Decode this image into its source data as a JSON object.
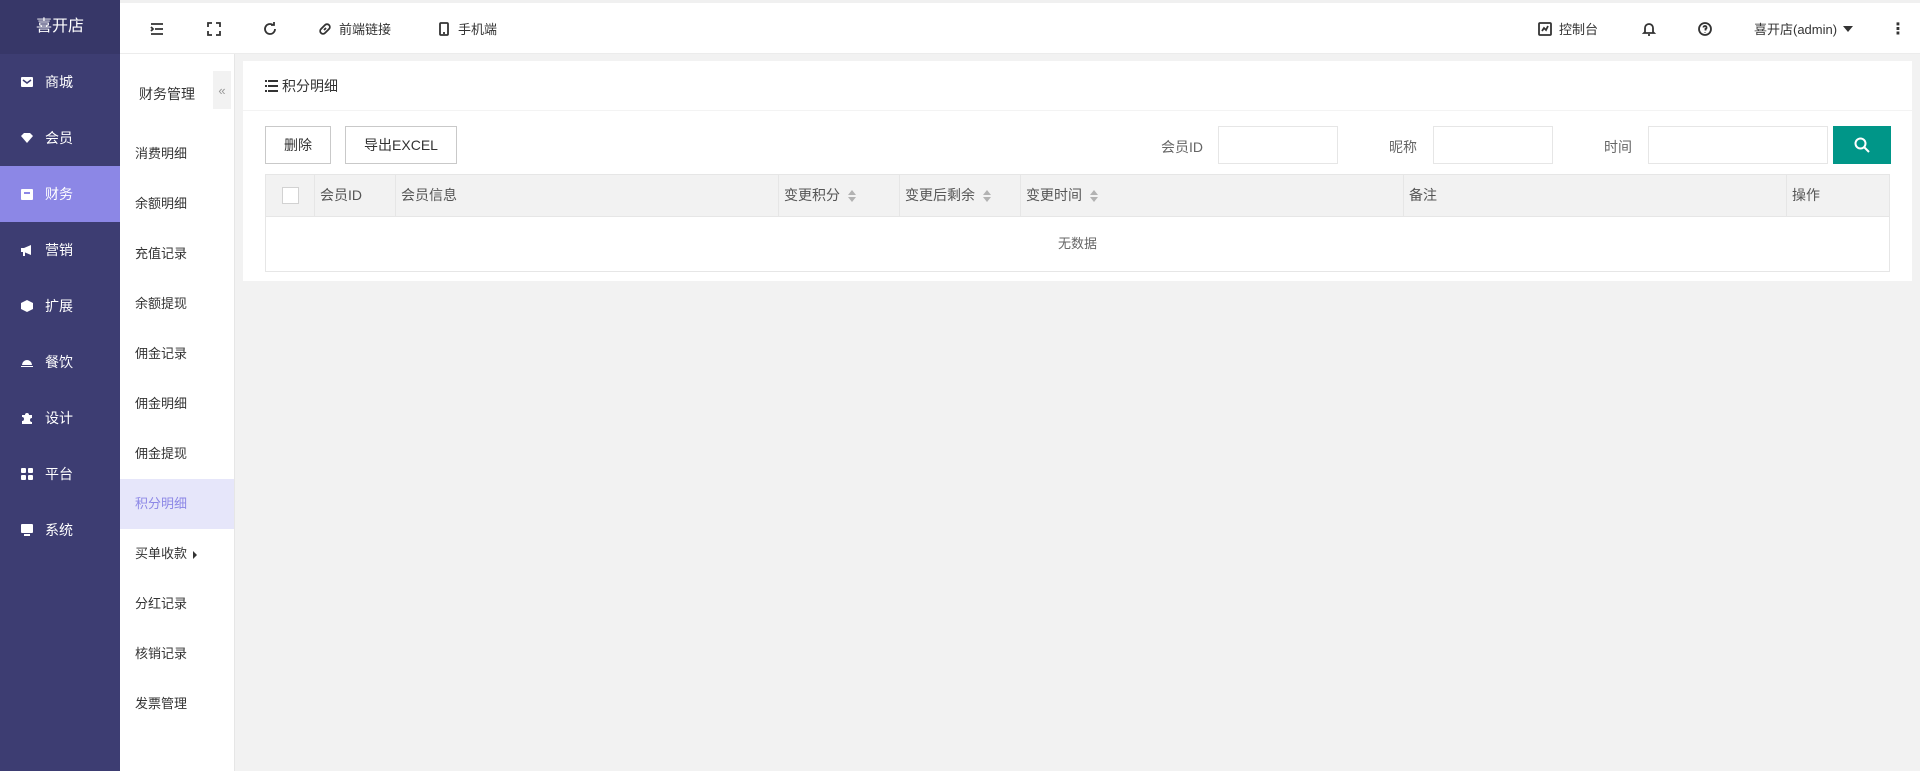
{
  "nav": {
    "brand": "喜开店",
    "items": [
      {
        "label": "商城",
        "icon": "shop-icon"
      },
      {
        "label": "会员",
        "icon": "member-icon"
      },
      {
        "label": "财务",
        "icon": "finance-icon",
        "active": true
      },
      {
        "label": "营销",
        "icon": "marketing-icon"
      },
      {
        "label": "扩展",
        "icon": "extension-icon"
      },
      {
        "label": "餐饮",
        "icon": "dining-icon"
      },
      {
        "label": "设计",
        "icon": "design-icon"
      },
      {
        "label": "平台",
        "icon": "platform-icon"
      },
      {
        "label": "系统",
        "icon": "system-icon"
      }
    ]
  },
  "subnav": {
    "title": "财务管理",
    "collapse": "«",
    "items": [
      "消费明细",
      "余额明细",
      "充值记录",
      "余额提现",
      "佣金记录",
      "佣金明细",
      "佣金提现",
      "积分明细",
      "买单收款",
      "分红记录",
      "核销记录",
      "发票管理"
    ],
    "active_index": 7
  },
  "topbar": {
    "frontend_link": "前端链接",
    "mobile": "手机端",
    "console": "控制台",
    "user": "喜开店(admin)"
  },
  "page": {
    "title": "积分明细",
    "delete_btn": "删除",
    "export_btn": "导出EXCEL",
    "filters": {
      "member_id": "会员ID",
      "nickname": "昵称",
      "time": "时间"
    },
    "columns": {
      "member_id": "会员ID",
      "member_info": "会员信息",
      "change_points": "变更积分",
      "remaining": "变更后剩余",
      "change_time": "变更时间",
      "remark": "备注",
      "action": "操作"
    },
    "empty_text": "无数据"
  },
  "colors": {
    "accent": "#8c87e6",
    "nav_bg": "#3d3d72",
    "search_btn": "#009688"
  }
}
